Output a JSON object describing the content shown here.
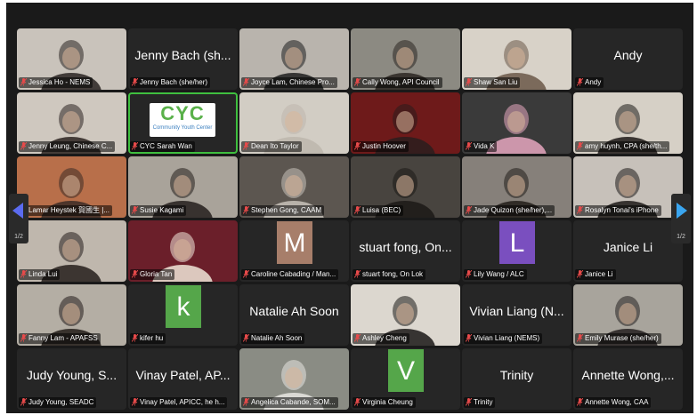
{
  "nav": {
    "prev_count": "1/2",
    "next_count": "1/2"
  },
  "tiles": [
    {
      "label": "Jessica Ho - NEMS",
      "kind": "video",
      "bg": "#c9c3bb",
      "person": "#2a2522"
    },
    {
      "label": "Jenny Bach (she/her)",
      "kind": "name",
      "name": "Jenny Bach (sh..."
    },
    {
      "label": "Joyce Lam, Chinese Pro...",
      "kind": "video",
      "bg": "#b9b4ad",
      "person": "#1e1e1e"
    },
    {
      "label": "Cally Wong, API Council",
      "kind": "video",
      "bg": "#8c8a82",
      "person": "#2b2622"
    },
    {
      "label": "Shaw San Liu",
      "kind": "video",
      "bg": "#d8d2c8",
      "person": "#6b5848"
    },
    {
      "label": "Andy",
      "kind": "name",
      "name": "Andy"
    },
    {
      "label": "Jenny Leung, Chinese C...",
      "kind": "video",
      "bg": "#cfc8bf",
      "person": "#2b2320"
    },
    {
      "label": "CYC Sarah Wan",
      "kind": "logo",
      "logo_text": "CYC",
      "logo_sub": "Community Youth Center"
    },
    {
      "label": "Dean Ito Taylor",
      "kind": "video",
      "bg": "#d2cdc4",
      "person": "#bdb6ad"
    },
    {
      "label": "Justin Hoover",
      "kind": "video",
      "bg": "#6e1a1a",
      "person": "#2a1e1e"
    },
    {
      "label": "Vida K",
      "kind": "video",
      "bg": "#3a3a3a",
      "person": "#e6a7c0"
    },
    {
      "label": "amy huynh, CPA (she/th...",
      "kind": "video",
      "bg": "#d6d0c6",
      "person": "#1e1a17"
    },
    {
      "label": "Lamar Heystek 賀國生 |...",
      "kind": "video",
      "bg": "#b86f4a",
      "person": "#3a2c26"
    },
    {
      "label": "Susie Kagami",
      "kind": "video",
      "bg": "#a9a39a",
      "person": "#241f1c"
    },
    {
      "label": "Stephen Gong, CAAM",
      "kind": "video",
      "bg": "#5c5650",
      "person": "#c8c2ba"
    },
    {
      "label": "Luisa (BEC)",
      "kind": "video",
      "bg": "#48443f",
      "person": "#1c1916"
    },
    {
      "label": "Jade Quizon (she/her),...",
      "kind": "video",
      "bg": "#86807a",
      "person": "#221d19"
    },
    {
      "label": "Rosalyn Tonai's iPhone",
      "kind": "video",
      "bg": "#c7c1ba",
      "person": "#1d1a18"
    },
    {
      "label": "Linda Lui",
      "kind": "video",
      "bg": "#bfb7ad",
      "person": "#241e1b"
    },
    {
      "label": "Gloria Tan",
      "kind": "video",
      "bg": "#6b1f2a",
      "person": "#f0e6d8"
    },
    {
      "label": "Caroline Cabading / Man...",
      "kind": "letter",
      "letter": "M",
      "color": "#a77e6a"
    },
    {
      "label": "stuart fong, On Lok",
      "kind": "name",
      "name": "stuart fong, On..."
    },
    {
      "label": "Lily Wang / ALC",
      "kind": "letter",
      "letter": "L",
      "color": "#7a4fbf"
    },
    {
      "label": "Janice Li",
      "kind": "name",
      "name": "Janice Li"
    },
    {
      "label": "Fanny Lam - APAFSS",
      "kind": "video",
      "bg": "#b4aea4",
      "person": "#221c19"
    },
    {
      "label": "kifer hu",
      "kind": "letter",
      "letter": "k",
      "color": "#55a64a"
    },
    {
      "label": "Natalie Ah Soon",
      "kind": "name",
      "name": "Natalie Ah Soon"
    },
    {
      "label": "Ashley Cheng",
      "kind": "video",
      "bg": "#dcd7cf",
      "person": "#1a1716"
    },
    {
      "label": "Vivian Liang (NEMS)",
      "kind": "name",
      "name": "Vivian Liang (N..."
    },
    {
      "label": "Emily Murase (she/her)",
      "kind": "video",
      "bg": "#a8a49c",
      "person": "#242020"
    },
    {
      "label": "Judy Young, SEADC",
      "kind": "name",
      "name": "Judy Young, S..."
    },
    {
      "label": "Vinay Patel, APICC, he h...",
      "kind": "name",
      "name": "Vinay Patel, AP..."
    },
    {
      "label": "Angelica Cabande, SOM...",
      "kind": "video",
      "bg": "#8a8c84",
      "person": "#e8e6e2"
    },
    {
      "label": "Virginia Cheung",
      "kind": "letter",
      "letter": "V",
      "color": "#55a64a"
    },
    {
      "label": "Trinity",
      "kind": "name",
      "name": "Trinity"
    },
    {
      "label": "Annette Wong, CAA",
      "kind": "name",
      "name": "Annette Wong,..."
    }
  ]
}
